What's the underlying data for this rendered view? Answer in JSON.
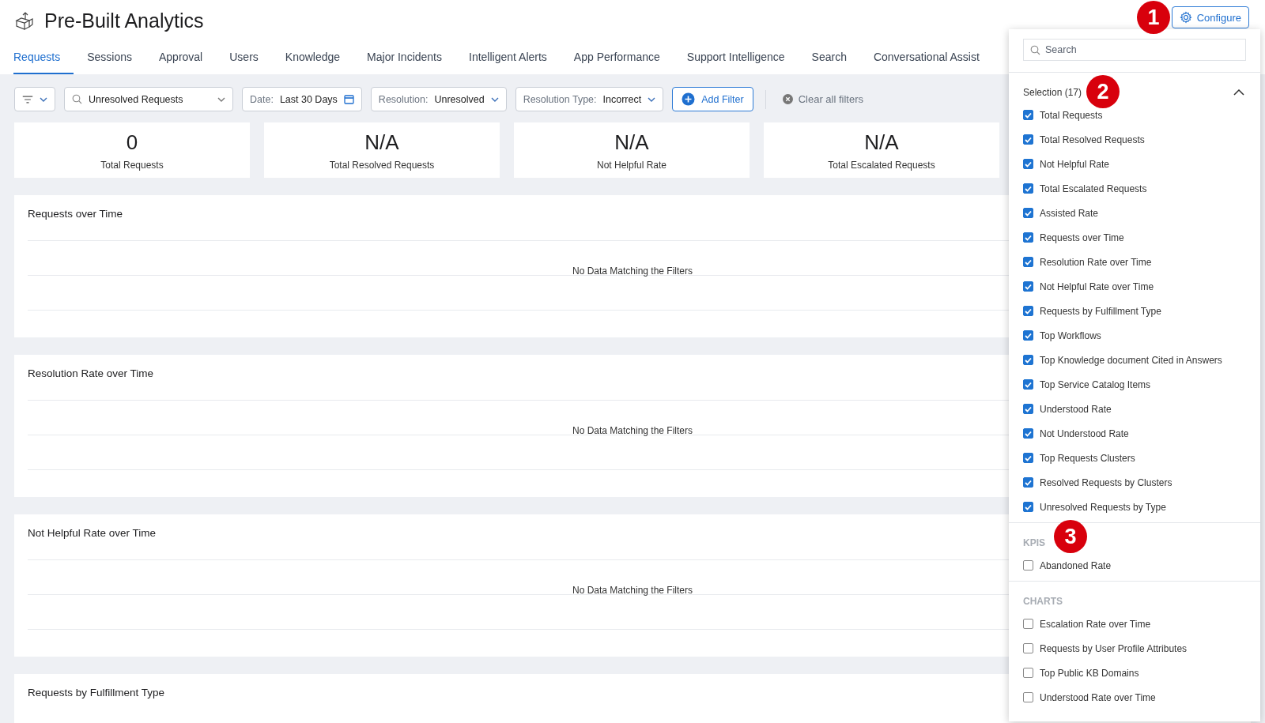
{
  "header": {
    "title": "Pre-Built Analytics",
    "configure_button": "Configure",
    "callout": "1"
  },
  "tabs": [
    {
      "label": "Requests",
      "selected": true
    },
    {
      "label": "Sessions",
      "selected": false
    },
    {
      "label": "Approval",
      "selected": false
    },
    {
      "label": "Users",
      "selected": false
    },
    {
      "label": "Knowledge",
      "selected": false
    },
    {
      "label": "Major Incidents",
      "selected": false
    },
    {
      "label": "Intelligent Alerts",
      "selected": false
    },
    {
      "label": "App Performance",
      "selected": false
    },
    {
      "label": "Support Intelligence",
      "selected": false
    },
    {
      "label": "Search",
      "selected": false
    },
    {
      "label": "Conversational Assist",
      "selected": false
    }
  ],
  "filters": {
    "report": "Unresolved Requests",
    "chips": [
      {
        "kind": "date",
        "label": "Date:",
        "value": "Last 30 Days"
      },
      {
        "kind": "select",
        "label": "Resolution:",
        "value": "Unresolved"
      },
      {
        "kind": "select",
        "label": "Resolution Type:",
        "value": "Incorrect"
      }
    ],
    "add_filter": "Add Filter",
    "clear": "Clear all filters"
  },
  "kpis": [
    {
      "value": "0",
      "label": "Total Requests"
    },
    {
      "value": "N/A",
      "label": "Total Resolved Requests"
    },
    {
      "value": "N/A",
      "label": "Not Helpful Rate"
    },
    {
      "value": "N/A",
      "label": "Total Escalated Requests"
    }
  ],
  "charts": [
    {
      "title": "Requests over Time",
      "message": "No Data Matching the Filters"
    },
    {
      "title": "Resolution Rate over Time",
      "message": "No Data Matching the Filters"
    },
    {
      "title": "Not Helpful Rate over Time",
      "message": "No Data Matching the Filters"
    },
    {
      "title": "Requests by Fulfillment Type"
    }
  ],
  "configure_panel": {
    "search_placeholder": "Search",
    "groups": [
      {
        "kind": "selection",
        "title": "Selection (17)",
        "expanded": true,
        "callout": "2",
        "items": [
          {
            "label": "Total Requests",
            "checked": true
          },
          {
            "label": "Total Resolved Requests",
            "checked": true
          },
          {
            "label": "Not Helpful Rate",
            "checked": true
          },
          {
            "label": "Total Escalated Requests",
            "checked": true
          },
          {
            "label": "Assisted Rate",
            "checked": true
          },
          {
            "label": "Requests over Time",
            "checked": true
          },
          {
            "label": "Resolution Rate over Time",
            "checked": true
          },
          {
            "label": "Not Helpful Rate over Time",
            "checked": true
          },
          {
            "label": "Requests by Fulfillment Type",
            "checked": true
          },
          {
            "label": "Top Workflows",
            "checked": true
          },
          {
            "label": "Top Knowledge document Cited in Answers",
            "checked": true
          },
          {
            "label": "Top Service Catalog Items",
            "checked": true
          },
          {
            "label": "Understood Rate",
            "checked": true
          },
          {
            "label": "Not Understood Rate",
            "checked": true
          },
          {
            "label": "Top Requests Clusters",
            "checked": true
          },
          {
            "label": "Resolved Requests by Clusters",
            "checked": true
          },
          {
            "label": "Unresolved Requests by Type",
            "checked": true
          }
        ]
      },
      {
        "kind": "category",
        "title": "KPIS",
        "callout": "3",
        "items": [
          {
            "label": "Abandoned Rate",
            "checked": false
          }
        ]
      },
      {
        "kind": "category",
        "title": "CHARTS",
        "items": [
          {
            "label": "Escalation Rate over Time",
            "checked": false
          },
          {
            "label": "Requests by User Profile Attributes",
            "checked": false
          },
          {
            "label": "Top Public KB Domains",
            "checked": false
          },
          {
            "label": "Understood Rate over Time",
            "checked": false
          }
        ]
      }
    ]
  }
}
